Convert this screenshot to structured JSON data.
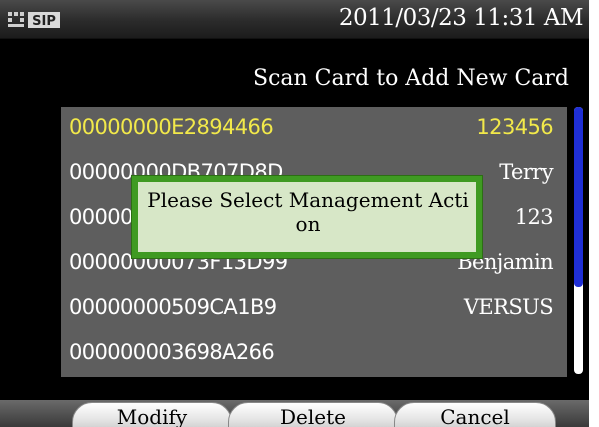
{
  "status_bar": {
    "sip_badge": "SIP",
    "clock": "2011/03/23 11:31 AM"
  },
  "instruction": "Scan Card to Add New Card",
  "cards": [
    {
      "id": "00000000E2894466",
      "name": "123456",
      "selected": true
    },
    {
      "id": "00000000DB707D8D",
      "name": "Terry",
      "selected": false
    },
    {
      "id": "000000003B7E5A21",
      "name": "123",
      "selected": false
    },
    {
      "id": "00000000073F13D99",
      "name": "Benjamin",
      "selected": false
    },
    {
      "id": "00000000509CA1B9",
      "name": "VERSUS",
      "selected": false
    },
    {
      "id": "000000003698A266",
      "name": "",
      "selected": false
    }
  ],
  "modal": {
    "message": "Please Select Management Action"
  },
  "softkeys": {
    "modify": "Modify",
    "delete": "Delete",
    "cancel": "Cancel"
  },
  "colors": {
    "selected_row": "#f2e94a",
    "modal_border": "#3f9a22",
    "modal_bg": "#d7e7c7",
    "scrollbar": "#1f2fd6"
  }
}
